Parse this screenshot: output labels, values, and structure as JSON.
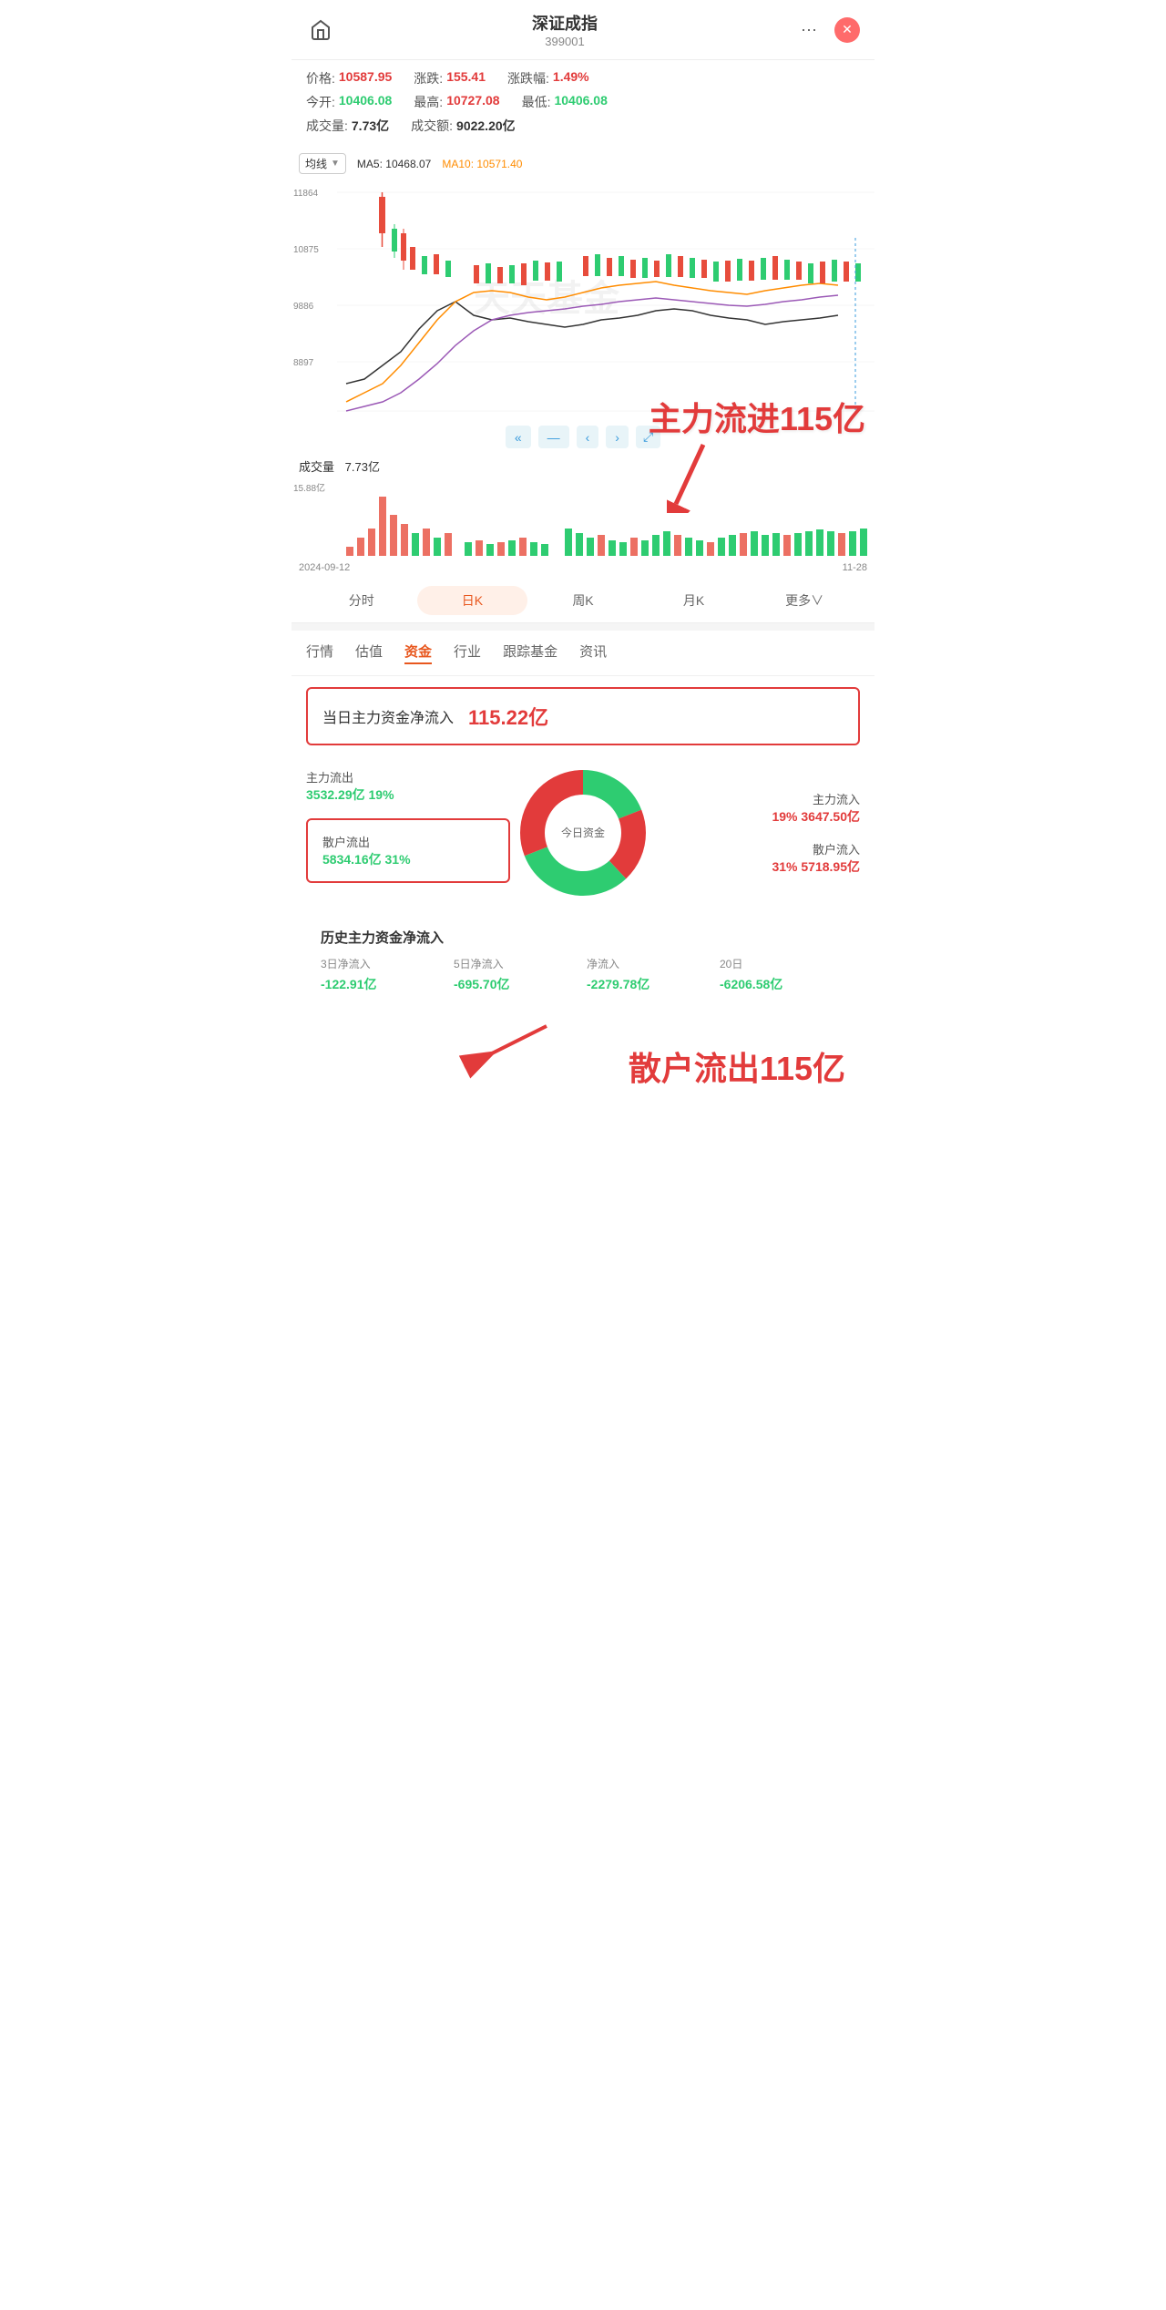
{
  "header": {
    "title": "深证成指",
    "code": "399001",
    "more_label": "···",
    "close_label": "✕"
  },
  "price_info": {
    "price_label": "价格:",
    "price_value": "10587.95",
    "change_label": "涨跌:",
    "change_value": "155.41",
    "change_pct_label": "涨跌幅:",
    "change_pct_value": "1.49%",
    "open_label": "今开:",
    "open_value": "10406.08",
    "high_label": "最高:",
    "high_value": "10727.08",
    "low_label": "最低:",
    "low_value": "10406.08",
    "volume_label": "成交量:",
    "volume_value": "7.73亿",
    "amount_label": "成交额:",
    "amount_value": "9022.20亿"
  },
  "chart": {
    "ma_selector_label": "均线",
    "ma5_label": "MA5:",
    "ma5_value": "10468.07",
    "ma10_label": "MA10:",
    "ma10_value": "10571.40",
    "y_labels": [
      "11864.11",
      "10875.21",
      "9886.32",
      "8897.42"
    ],
    "watermark": "天天基金",
    "nav_buttons": [
      "«",
      "—",
      "‹",
      "›",
      "⤢"
    ],
    "volume_label": "成交量",
    "volume_value": "7.73亿",
    "date_label": "2024-09-12",
    "y_top": "15.88亿"
  },
  "period_tabs": [
    {
      "label": "分时",
      "active": false
    },
    {
      "label": "日K",
      "active": true
    },
    {
      "label": "周K",
      "active": false
    },
    {
      "label": "月K",
      "active": false
    },
    {
      "label": "更多∨",
      "active": false
    }
  ],
  "nav_tabs": [
    {
      "label": "行情",
      "active": false
    },
    {
      "label": "估值",
      "active": false
    },
    {
      "label": "资金",
      "active": true
    },
    {
      "label": "行业",
      "active": false
    },
    {
      "label": "跟踪基金",
      "active": false
    },
    {
      "label": "资讯",
      "active": false
    }
  ],
  "fund_flow": {
    "main_flow_label": "当日主力资金净流入",
    "main_flow_value": "115.22亿",
    "outflow_left_label": "主力流出",
    "outflow_left_values": "3532.29亿 19%",
    "inflow_right_label": "主力流入",
    "inflow_right_values": "19% 3647.50亿",
    "retail_out_label": "散户流出",
    "retail_out_values": "5834.16亿 31%",
    "retail_in_label": "散户流入",
    "retail_in_values": "31% 5718.95亿",
    "donut_center_label": "今日资金"
  },
  "history_flow": {
    "title": "历史主力资金净流入",
    "items": [
      {
        "label": "3日净流入",
        "value": "-122.91亿"
      },
      {
        "label": "5日净流入",
        "value": "-695.70亿"
      },
      {
        "label": "净流入",
        "value": "-2279.78亿"
      },
      {
        "label": "20日",
        "value": "-6206.58亿"
      }
    ]
  },
  "annotations": {
    "text1": "主力流进115亿",
    "text2": "散户流出115亿"
  }
}
